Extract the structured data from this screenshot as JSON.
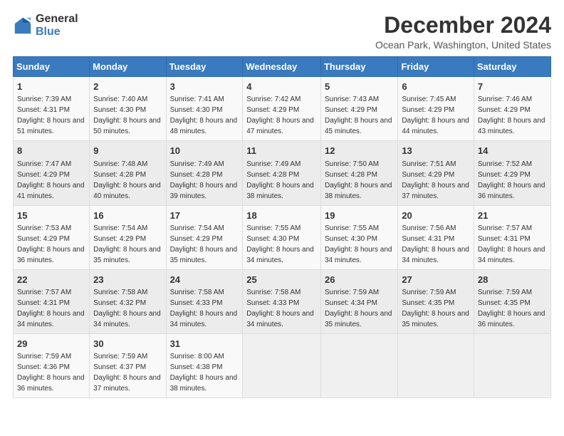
{
  "logo": {
    "general": "General",
    "blue": "Blue"
  },
  "title": "December 2024",
  "subtitle": "Ocean Park, Washington, United States",
  "days_header": [
    "Sunday",
    "Monday",
    "Tuesday",
    "Wednesday",
    "Thursday",
    "Friday",
    "Saturday"
  ],
  "weeks": [
    [
      {
        "day": "1",
        "sunrise": "7:39 AM",
        "sunset": "4:31 PM",
        "daylight": "8 hours and 51 minutes."
      },
      {
        "day": "2",
        "sunrise": "7:40 AM",
        "sunset": "4:30 PM",
        "daylight": "8 hours and 50 minutes."
      },
      {
        "day": "3",
        "sunrise": "7:41 AM",
        "sunset": "4:30 PM",
        "daylight": "8 hours and 48 minutes."
      },
      {
        "day": "4",
        "sunrise": "7:42 AM",
        "sunset": "4:29 PM",
        "daylight": "8 hours and 47 minutes."
      },
      {
        "day": "5",
        "sunrise": "7:43 AM",
        "sunset": "4:29 PM",
        "daylight": "8 hours and 45 minutes."
      },
      {
        "day": "6",
        "sunrise": "7:45 AM",
        "sunset": "4:29 PM",
        "daylight": "8 hours and 44 minutes."
      },
      {
        "day": "7",
        "sunrise": "7:46 AM",
        "sunset": "4:29 PM",
        "daylight": "8 hours and 43 minutes."
      }
    ],
    [
      {
        "day": "8",
        "sunrise": "7:47 AM",
        "sunset": "4:29 PM",
        "daylight": "8 hours and 41 minutes."
      },
      {
        "day": "9",
        "sunrise": "7:48 AM",
        "sunset": "4:28 PM",
        "daylight": "8 hours and 40 minutes."
      },
      {
        "day": "10",
        "sunrise": "7:49 AM",
        "sunset": "4:28 PM",
        "daylight": "8 hours and 39 minutes."
      },
      {
        "day": "11",
        "sunrise": "7:49 AM",
        "sunset": "4:28 PM",
        "daylight": "8 hours and 38 minutes."
      },
      {
        "day": "12",
        "sunrise": "7:50 AM",
        "sunset": "4:28 PM",
        "daylight": "8 hours and 38 minutes."
      },
      {
        "day": "13",
        "sunrise": "7:51 AM",
        "sunset": "4:29 PM",
        "daylight": "8 hours and 37 minutes."
      },
      {
        "day": "14",
        "sunrise": "7:52 AM",
        "sunset": "4:29 PM",
        "daylight": "8 hours and 36 minutes."
      }
    ],
    [
      {
        "day": "15",
        "sunrise": "7:53 AM",
        "sunset": "4:29 PM",
        "daylight": "8 hours and 36 minutes."
      },
      {
        "day": "16",
        "sunrise": "7:54 AM",
        "sunset": "4:29 PM",
        "daylight": "8 hours and 35 minutes."
      },
      {
        "day": "17",
        "sunrise": "7:54 AM",
        "sunset": "4:29 PM",
        "daylight": "8 hours and 35 minutes."
      },
      {
        "day": "18",
        "sunrise": "7:55 AM",
        "sunset": "4:30 PM",
        "daylight": "8 hours and 34 minutes."
      },
      {
        "day": "19",
        "sunrise": "7:55 AM",
        "sunset": "4:30 PM",
        "daylight": "8 hours and 34 minutes."
      },
      {
        "day": "20",
        "sunrise": "7:56 AM",
        "sunset": "4:31 PM",
        "daylight": "8 hours and 34 minutes."
      },
      {
        "day": "21",
        "sunrise": "7:57 AM",
        "sunset": "4:31 PM",
        "daylight": "8 hours and 34 minutes."
      }
    ],
    [
      {
        "day": "22",
        "sunrise": "7:57 AM",
        "sunset": "4:31 PM",
        "daylight": "8 hours and 34 minutes."
      },
      {
        "day": "23",
        "sunrise": "7:58 AM",
        "sunset": "4:32 PM",
        "daylight": "8 hours and 34 minutes."
      },
      {
        "day": "24",
        "sunrise": "7:58 AM",
        "sunset": "4:33 PM",
        "daylight": "8 hours and 34 minutes."
      },
      {
        "day": "25",
        "sunrise": "7:58 AM",
        "sunset": "4:33 PM",
        "daylight": "8 hours and 34 minutes."
      },
      {
        "day": "26",
        "sunrise": "7:59 AM",
        "sunset": "4:34 PM",
        "daylight": "8 hours and 35 minutes."
      },
      {
        "day": "27",
        "sunrise": "7:59 AM",
        "sunset": "4:35 PM",
        "daylight": "8 hours and 35 minutes."
      },
      {
        "day": "28",
        "sunrise": "7:59 AM",
        "sunset": "4:35 PM",
        "daylight": "8 hours and 36 minutes."
      }
    ],
    [
      {
        "day": "29",
        "sunrise": "7:59 AM",
        "sunset": "4:36 PM",
        "daylight": "8 hours and 36 minutes."
      },
      {
        "day": "30",
        "sunrise": "7:59 AM",
        "sunset": "4:37 PM",
        "daylight": "8 hours and 37 minutes."
      },
      {
        "day": "31",
        "sunrise": "8:00 AM",
        "sunset": "4:38 PM",
        "daylight": "8 hours and 38 minutes."
      },
      null,
      null,
      null,
      null
    ]
  ]
}
